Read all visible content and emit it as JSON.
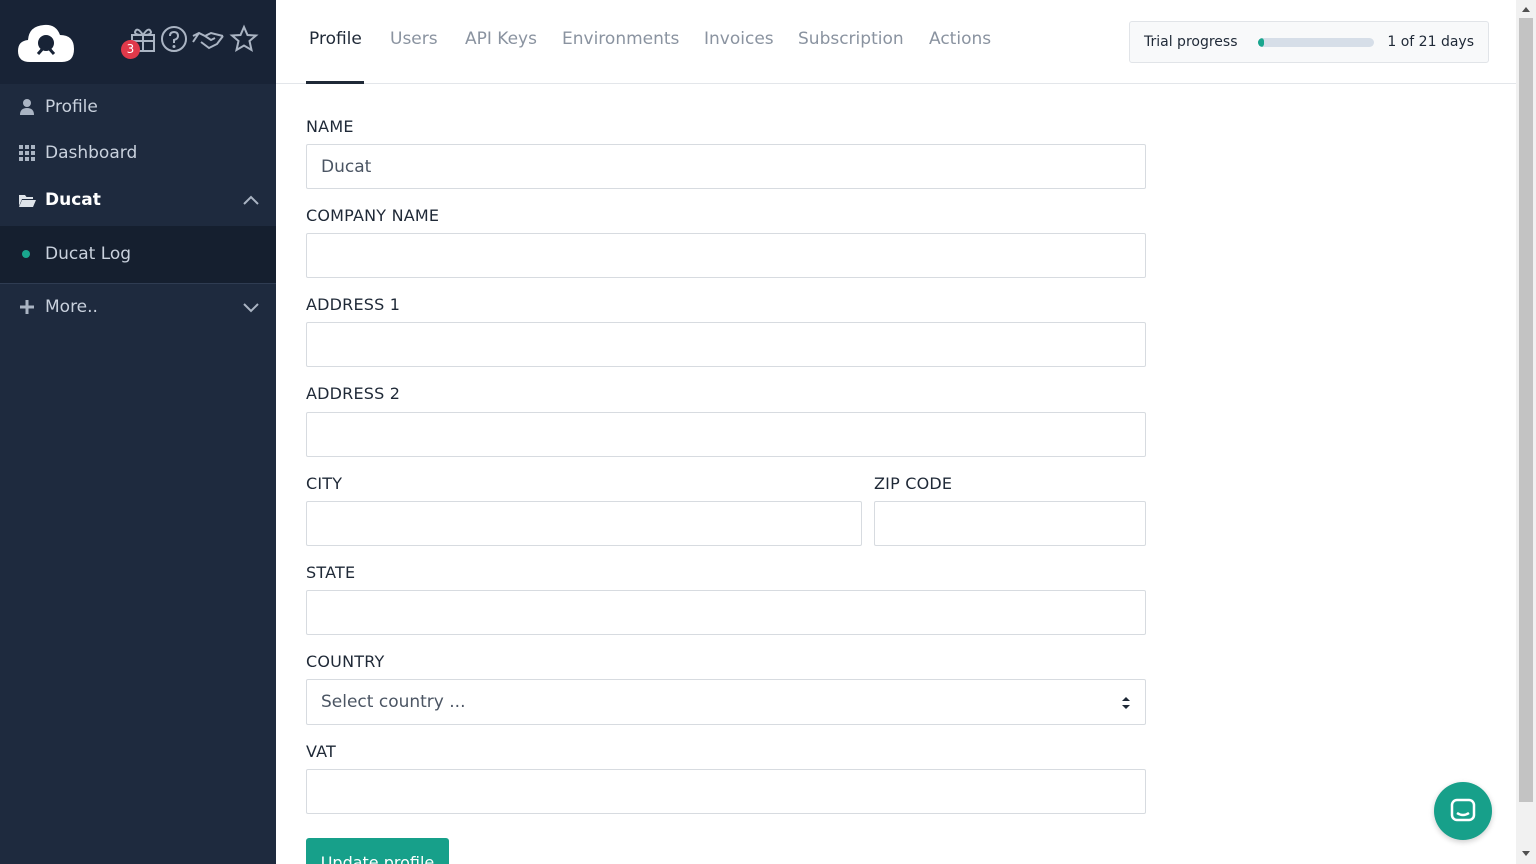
{
  "sidebar": {
    "notification_count": "3",
    "header_icons": [
      "gift-icon",
      "help-circle-icon",
      "handshake-icon",
      "star-icon"
    ],
    "items": [
      {
        "label": "Profile",
        "icon": "user-icon"
      },
      {
        "label": "Dashboard",
        "icon": "grid-icon"
      },
      {
        "label": "Ducat",
        "icon": "folder-open-icon",
        "expanded": true
      },
      {
        "label": "Ducat Log",
        "icon": "dot-icon"
      },
      {
        "label": "More..",
        "icon": "plus-icon",
        "expanded": false
      }
    ]
  },
  "tabs": [
    {
      "label": "Profile",
      "active": true
    },
    {
      "label": "Users"
    },
    {
      "label": "API Keys"
    },
    {
      "label": "Environments"
    },
    {
      "label": "Invoices"
    },
    {
      "label": "Subscription"
    },
    {
      "label": "Actions"
    }
  ],
  "trial": {
    "label": "Trial progress",
    "days_text": "1 of 21 days",
    "progress_fraction": 0.048
  },
  "form": {
    "name": {
      "label": "NAME",
      "value": "Ducat"
    },
    "company": {
      "label": "COMPANY NAME",
      "value": ""
    },
    "address1": {
      "label": "ADDRESS 1",
      "value": ""
    },
    "address2": {
      "label": "ADDRESS 2",
      "value": ""
    },
    "city": {
      "label": "CITY",
      "value": ""
    },
    "zip": {
      "label": "ZIP CODE",
      "value": ""
    },
    "state": {
      "label": "STATE",
      "value": ""
    },
    "country": {
      "label": "COUNTRY",
      "selected": "Select country ..."
    },
    "vat": {
      "label": "VAT",
      "value": ""
    },
    "submit_label": "Update profile"
  },
  "colors": {
    "sidebar_bg": "#1e2a3e",
    "accent": "#17a08a",
    "badge": "#e0394a"
  }
}
